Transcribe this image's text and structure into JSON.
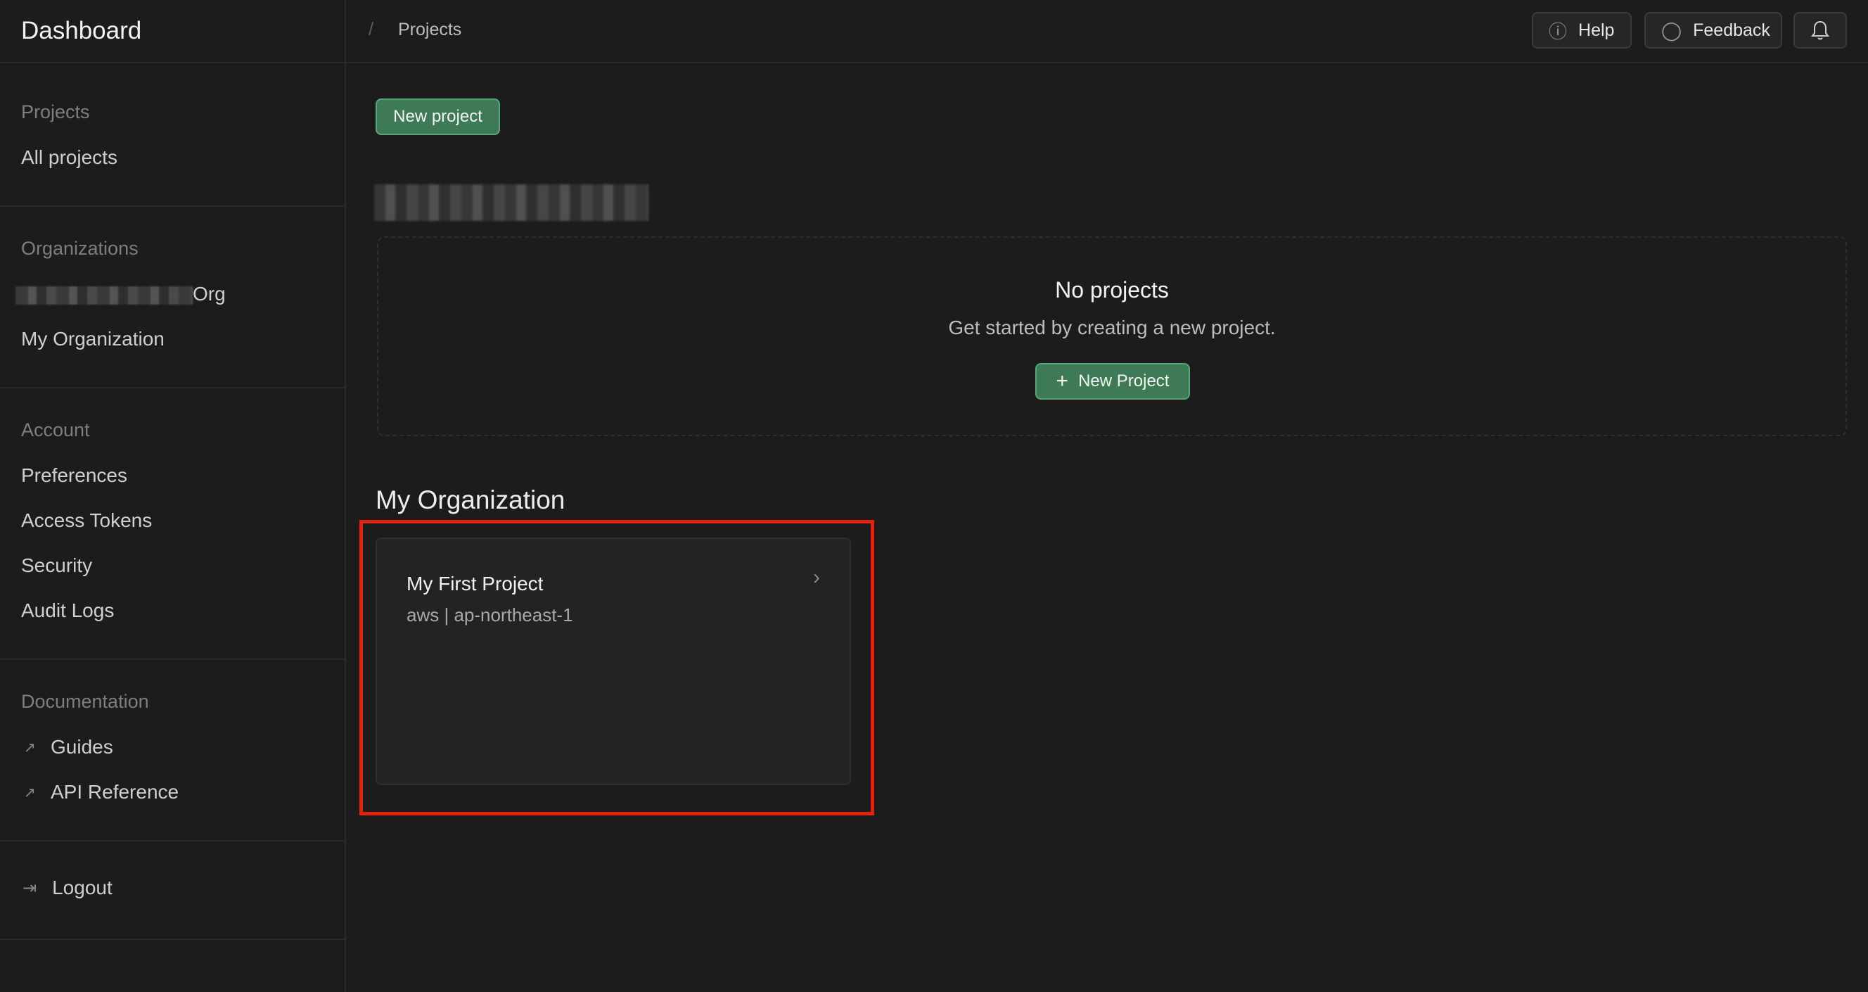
{
  "sidebar": {
    "brand": "Dashboard",
    "projects_heading": "Projects",
    "all_projects": "All projects",
    "organizations_heading": "Organizations",
    "org_redacted_suffix": "Org",
    "my_organization": "My Organization",
    "account_heading": "Account",
    "preferences": "Preferences",
    "access_tokens": "Access Tokens",
    "security": "Security",
    "audit_logs": "Audit Logs",
    "documentation_heading": "Documentation",
    "guides": "Guides",
    "api_reference": "API Reference",
    "logout": "Logout"
  },
  "topbar": {
    "breadcrumb": "Projects",
    "help": "Help",
    "feedback": "Feedback"
  },
  "main": {
    "new_project_button": "New project",
    "empty_title": "No projects",
    "empty_subtitle": "Get started by creating a new project.",
    "empty_new_project_button": "New Project",
    "org_section_title": "My Organization",
    "project_card": {
      "title": "My First Project",
      "subtitle": "aws | ap-northeast-1"
    }
  },
  "colors": {
    "accent_green": "#3e7a55",
    "highlight_red": "#e0220f"
  }
}
